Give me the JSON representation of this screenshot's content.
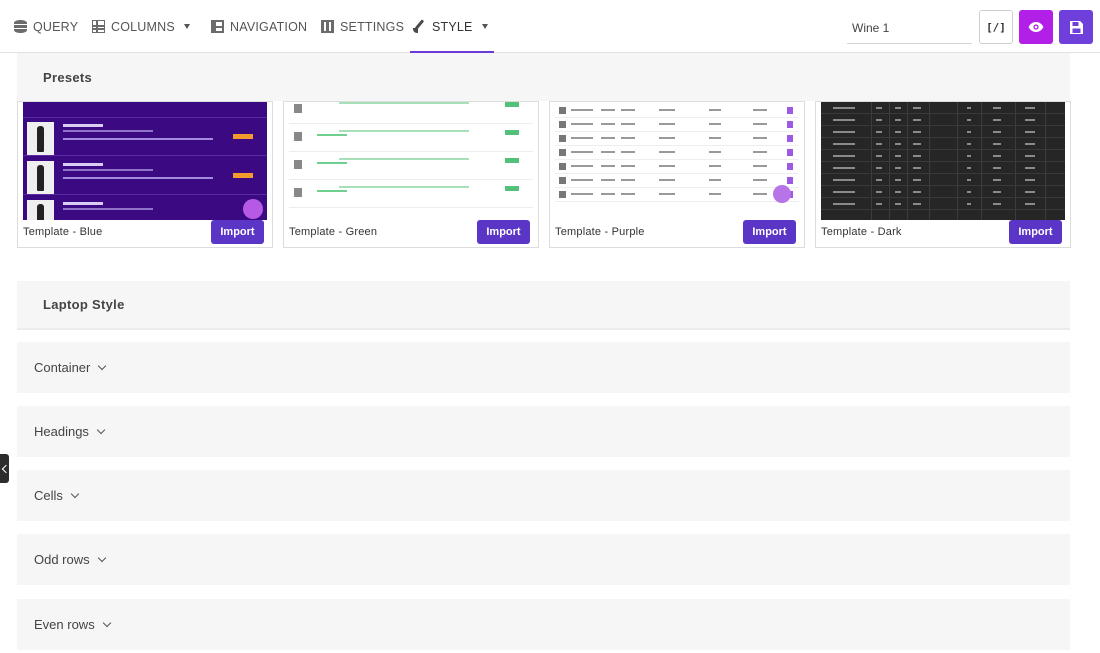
{
  "tabs": [
    {
      "label": "QUERY",
      "icon": "database-icon"
    },
    {
      "label": "COLUMNS",
      "icon": "columns-icon"
    },
    {
      "label": "NAVIGATION",
      "icon": "navigation-icon"
    },
    {
      "label": "SETTINGS",
      "icon": "settings-icon"
    },
    {
      "label": "STYLE",
      "icon": "brush-icon",
      "active": true
    }
  ],
  "header": {
    "title_value": "Wine 1",
    "code_button_label": "[/]"
  },
  "presets": {
    "heading": "Presets",
    "import_label": "Import",
    "templates": [
      {
        "name": "Template - Blue"
      },
      {
        "name": "Template - Green"
      },
      {
        "name": "Template - Purple"
      },
      {
        "name": "Template - Dark"
      }
    ]
  },
  "laptop_style": {
    "heading": "Laptop Style",
    "sections": [
      "Container",
      "Headings",
      "Cells",
      "Odd rows",
      "Even rows"
    ]
  },
  "colors": {
    "accent": "#6c3ad9",
    "import_button": "#5b36c6",
    "preview_button": "#b21fe6",
    "save_button": "#6f3fdc"
  }
}
